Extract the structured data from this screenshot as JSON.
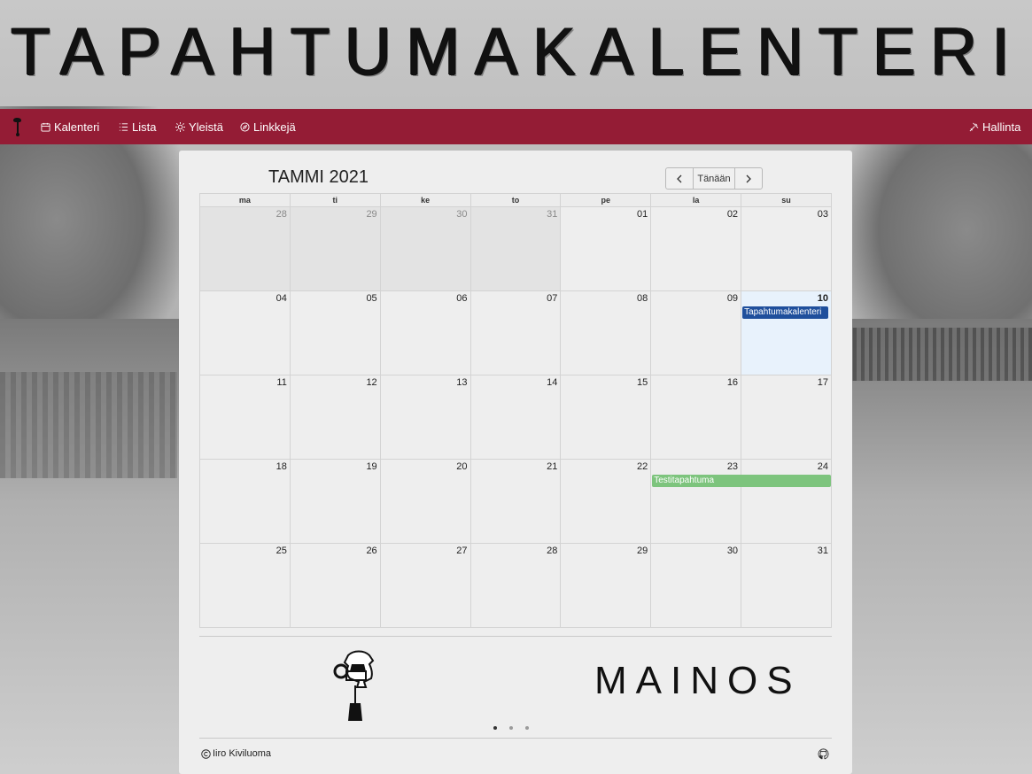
{
  "header": {
    "title": "TAPAHTUMAKALENTERI"
  },
  "nav": {
    "items": [
      {
        "label": "Kalenteri",
        "icon": "calendar-icon"
      },
      {
        "label": "Lista",
        "icon": "list-icon"
      },
      {
        "label": "Yleistä",
        "icon": "sun-icon"
      },
      {
        "label": "Linkkejä",
        "icon": "compass-icon"
      }
    ],
    "admin": {
      "label": "Hallinta",
      "icon": "tools-icon"
    }
  },
  "calendar": {
    "title": "TAMMI 2021",
    "today_label": "Tänään",
    "weekdays": [
      "ma",
      "ti",
      "ke",
      "to",
      "pe",
      "la",
      "su"
    ],
    "weeks": [
      [
        "28",
        "29",
        "30",
        "31",
        "01",
        "02",
        "03"
      ],
      [
        "04",
        "05",
        "06",
        "07",
        "08",
        "09",
        "10"
      ],
      [
        "11",
        "12",
        "13",
        "14",
        "15",
        "16",
        "17"
      ],
      [
        "18",
        "19",
        "20",
        "21",
        "22",
        "23",
        "24"
      ],
      [
        "25",
        "26",
        "27",
        "28",
        "29",
        "30",
        "31"
      ]
    ],
    "events": [
      {
        "title": "Tapahtumakalenteri",
        "date": "10",
        "color": "#1f4f9c"
      },
      {
        "title": "Testitapahtuma",
        "start": "23",
        "end": "24",
        "color": "#7dc47d"
      }
    ]
  },
  "ads": {
    "mainos_text": "MAINOS",
    "slides_count": 3,
    "active_slide": 1
  },
  "footer": {
    "copyright_symbol": "©",
    "author": "Iiro Kiviluoma"
  },
  "colors": {
    "navbar": "#941c35",
    "today": "#e8f2fc",
    "event_blue": "#1f4f9c",
    "event_green": "#7dc47d"
  }
}
